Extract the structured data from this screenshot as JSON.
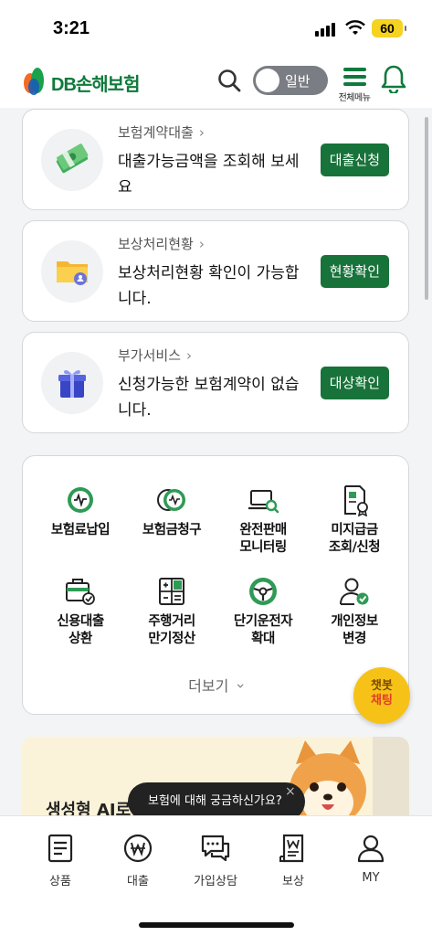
{
  "status_bar": {
    "time": "3:21",
    "battery": "60",
    "battery_color": "#f5d320"
  },
  "header": {
    "logo_text": "DB손해보험",
    "brand_color": "#0f7a3c",
    "toggle_label": "일반",
    "menu_label": "전체메뉴",
    "icons": [
      "search-icon",
      "hamburger-menu-icon",
      "bell-icon"
    ]
  },
  "cards": [
    {
      "category": "보험계약대출",
      "description": "대출가능금액을 조회해 보세요",
      "button": "대출신청",
      "icon": "money-stack-icon"
    },
    {
      "category": "보상처리현황",
      "description": "보상처리현황 확인이 가능합니다.",
      "button": "현황확인",
      "icon": "folder-user-icon"
    },
    {
      "category": "부가서비스",
      "description": "신청가능한 보험계약이 없습니다.",
      "button": "대상확인",
      "icon": "gift-box-icon"
    }
  ],
  "accent_button_color": "#18733a",
  "quick_menu": {
    "items": [
      {
        "label": "보험료납입",
        "icon": "premium-payment-icon"
      },
      {
        "label": "보험금청구",
        "icon": "claim-coins-icon"
      },
      {
        "label": "완전판매\n모니터링",
        "icon": "laptop-search-icon"
      },
      {
        "label": "미지급금\n조회/신청",
        "icon": "certificate-icon"
      },
      {
        "label": "신용대출\n상환",
        "icon": "briefcase-check-icon"
      },
      {
        "label": "주행거리\n만기정산",
        "icon": "calculator-icon"
      },
      {
        "label": "단기운전자\n확대",
        "icon": "steering-wheel-icon"
      },
      {
        "label": "개인정보\n변경",
        "icon": "user-check-icon"
      }
    ],
    "more_label": "더보기"
  },
  "chatbot_fab": {
    "line1": "챗봇",
    "line2": "채팅"
  },
  "banner": {
    "text": "생성형 AI로"
  },
  "tooltip": {
    "text": "보험에 대해 궁금하신가요?",
    "close": "×"
  },
  "bottom_nav": [
    {
      "label": "상품",
      "icon": "document-list-icon"
    },
    {
      "label": "대출",
      "icon": "won-coin-icon"
    },
    {
      "label": "가입상담",
      "icon": "chat-bubbles-icon"
    },
    {
      "label": "보상",
      "icon": "receipt-won-icon"
    },
    {
      "label": "MY",
      "icon": "user-icon"
    }
  ]
}
